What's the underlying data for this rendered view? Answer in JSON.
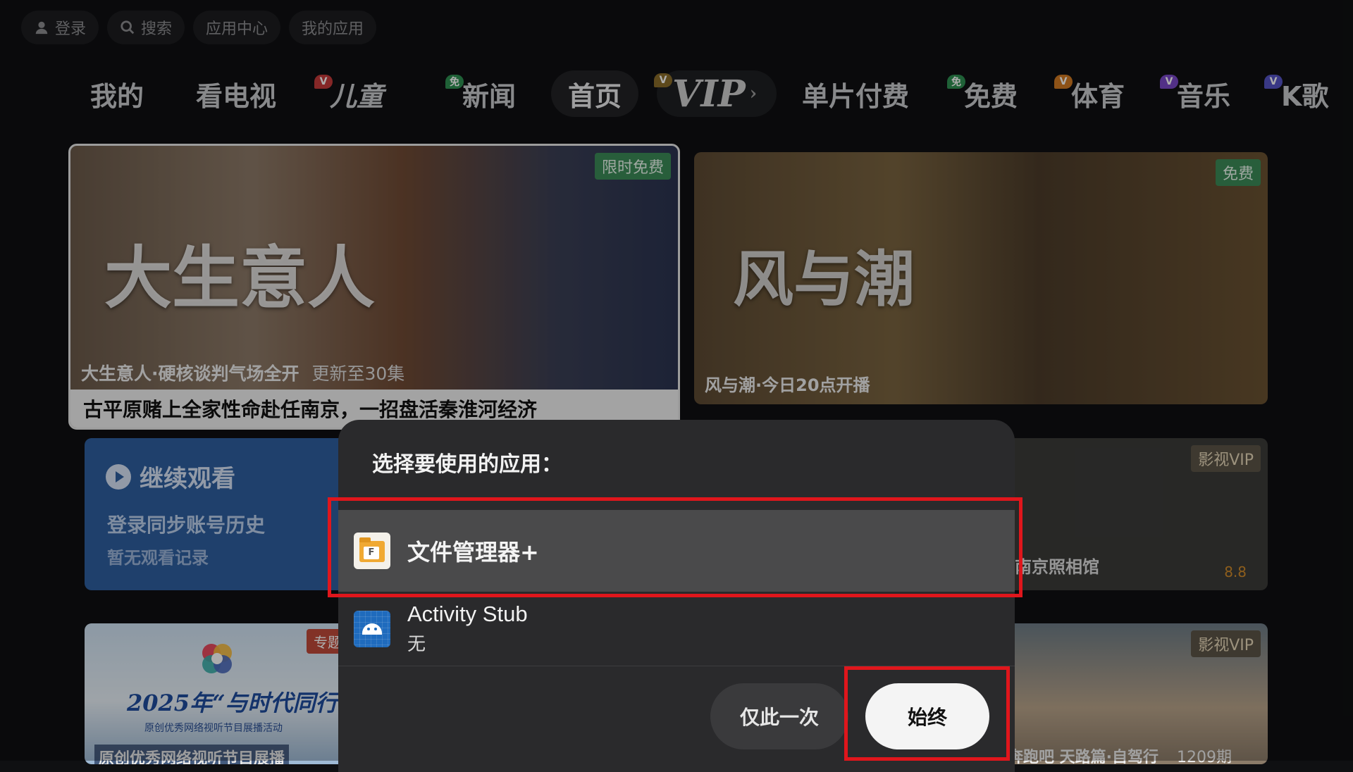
{
  "top_bar": {
    "login": "登录",
    "search": "搜索",
    "app_center": "应用中心",
    "my_apps": "我的应用"
  },
  "nav": {
    "items": [
      {
        "label": "我的"
      },
      {
        "label": "看电视"
      },
      {
        "label": "儿童",
        "badge": "V"
      },
      {
        "label": "新闻",
        "badge": "免"
      },
      {
        "label": "首页"
      },
      {
        "label": "VIP",
        "badge": "V"
      },
      {
        "label": "单片付费"
      },
      {
        "label": "免费",
        "badge": "免"
      },
      {
        "label": "体育",
        "badge": "V"
      },
      {
        "label": "音乐",
        "badge": "V"
      },
      {
        "label": "K歌",
        "badge": "V"
      }
    ],
    "vip_arrow": "›"
  },
  "cards": {
    "featured": {
      "art_title": "大生意人",
      "tag": "限时免费",
      "subtitle": "大生意人·硬核谈判气场全开",
      "episodes": "更新至30集",
      "caption": "古平原赌上全家性命赴任南京，一招盘活秦淮河经济"
    },
    "second": {
      "art_title": "风与潮",
      "tag": "免费",
      "caption": "风与潮·今日20点开播"
    },
    "continue": {
      "title": "继续观看",
      "sub": "登录同步账号历史",
      "empty": "暂无观看记录"
    },
    "photo_studio": {
      "tag": "影视VIP",
      "caption": "南京照相馆",
      "score": "8.8"
    },
    "special": {
      "tag": "专题",
      "headline": "2025年“与时代同行”",
      "sub": "原创优秀网络视听节目展播活动",
      "bottom": "原创优秀网络视听节目展播"
    },
    "variety": {
      "tag": "影视VIP",
      "caption": "奔跑吧 天路篇·自驾行",
      "issue": "1209期"
    }
  },
  "dialog": {
    "title": "选择要使用的应用：",
    "options": [
      {
        "name": "文件管理器+",
        "icon": "file-manager-icon",
        "icon_letter": "F"
      },
      {
        "name": "Activity Stub",
        "sub": "无",
        "icon": "android-icon"
      }
    ],
    "buttons": {
      "once": "仅此一次",
      "always": "始终"
    }
  },
  "colors": {
    "highlight": "#e0161c",
    "dialog_bg": "#2a2a2c",
    "selected_row": "#4a4a4b"
  }
}
